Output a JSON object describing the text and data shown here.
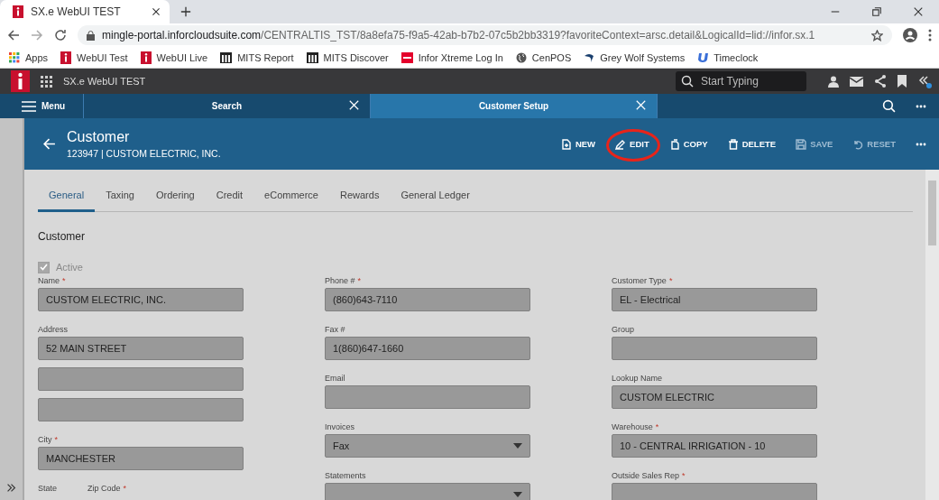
{
  "browser": {
    "tab_title": "SX.e WebUI TEST",
    "url": {
      "host": "mingle-portal.inforcloudsuite.com",
      "path": "/CENTRALTIS_TST/8a8efa75-f9a5-42ab-b7b2-07c5b2bb3319?favoriteContext=arsc.detail&LogicalId=lid://infor.sx.1"
    },
    "bookmarks": [
      {
        "label": "Apps",
        "kind": "apps"
      },
      {
        "label": "WebUI Test",
        "kind": "infor"
      },
      {
        "label": "WebUI Live",
        "kind": "infor"
      },
      {
        "label": "MITS Report",
        "kind": "mits"
      },
      {
        "label": "MITS Discover",
        "kind": "mits"
      },
      {
        "label": "Infor Xtreme Log In",
        "kind": "xtreme"
      },
      {
        "label": "CenPOS",
        "kind": "globe"
      },
      {
        "label": "Grey Wolf Systems",
        "kind": "wolf"
      },
      {
        "label": "Timeclock",
        "kind": "clock"
      }
    ]
  },
  "app_header": {
    "title": "SX.e WebUI TEST",
    "search": {
      "placeholder": "Start Typing"
    }
  },
  "nav": {
    "menu": "Menu",
    "tabs": [
      {
        "label": "Search",
        "selected": false
      },
      {
        "label": "Customer Setup",
        "selected": true
      }
    ]
  },
  "record": {
    "title": "Customer",
    "subtitle": "123947 | CUSTOM ELECTRIC, INC.",
    "actions": [
      {
        "label": "NEW",
        "kind": "new",
        "disabled": false,
        "circled": false
      },
      {
        "label": "EDIT",
        "kind": "edit",
        "disabled": false,
        "circled": true
      },
      {
        "label": "COPY",
        "kind": "copy",
        "disabled": false,
        "circled": false
      },
      {
        "label": "DELETE",
        "kind": "delete",
        "disabled": false,
        "circled": false
      },
      {
        "label": "SAVE",
        "kind": "save",
        "disabled": true,
        "circled": false
      },
      {
        "label": "RESET",
        "kind": "reset",
        "disabled": true,
        "circled": false
      }
    ]
  },
  "tabs": [
    {
      "label": "General",
      "selected": true
    },
    {
      "label": "Taxing",
      "selected": false
    },
    {
      "label": "Ordering",
      "selected": false
    },
    {
      "label": "Credit",
      "selected": false
    },
    {
      "label": "eCommerce",
      "selected": false
    },
    {
      "label": "Rewards",
      "selected": false
    },
    {
      "label": "General Ledger",
      "selected": false
    }
  ],
  "section": {
    "title": "Customer",
    "active": {
      "label": "Active",
      "checked": true
    }
  },
  "columns": [
    [
      {
        "kind": "text",
        "label": "Name",
        "required_mark": "*",
        "value": "CUSTOM ELECTRIC, INC."
      },
      {
        "kind": "text",
        "label": "Address",
        "value": "52 MAIN STREET"
      },
      {
        "kind": "line"
      },
      {
        "kind": "line"
      },
      {
        "kind": "text",
        "label": "City",
        "required_mark": "*",
        "value": "MANCHESTER"
      },
      {
        "kind": "pair",
        "labels": [
          {
            "label": "State"
          },
          {
            "label": "Zip Code",
            "required_mark": "*"
          }
        ]
      }
    ],
    [
      {
        "kind": "text",
        "label": "Phone #",
        "required_mark": "*",
        "value": "(860)643-7110"
      },
      {
        "kind": "text",
        "label": "Fax #",
        "value": "1(860)647-1660"
      },
      {
        "kind": "text",
        "label": "Email"
      },
      {
        "kind": "select",
        "label": "Invoices",
        "value": "Fax"
      },
      {
        "kind": "select",
        "label": "Statements"
      }
    ],
    [
      {
        "kind": "text",
        "label": "Customer Type",
        "required_mark": "*",
        "value": "EL - Electrical"
      },
      {
        "kind": "text",
        "label": "Group"
      },
      {
        "kind": "text",
        "label": "Lookup Name",
        "value": "CUSTOM ELECTRIC"
      },
      {
        "kind": "text",
        "label": "Warehouse",
        "required_mark": "*",
        "value": "10 - CENTRAL IRRIGATION - 10"
      },
      {
        "kind": "text",
        "label": "Outside Sales Rep",
        "required_mark": "*"
      }
    ]
  ]
}
